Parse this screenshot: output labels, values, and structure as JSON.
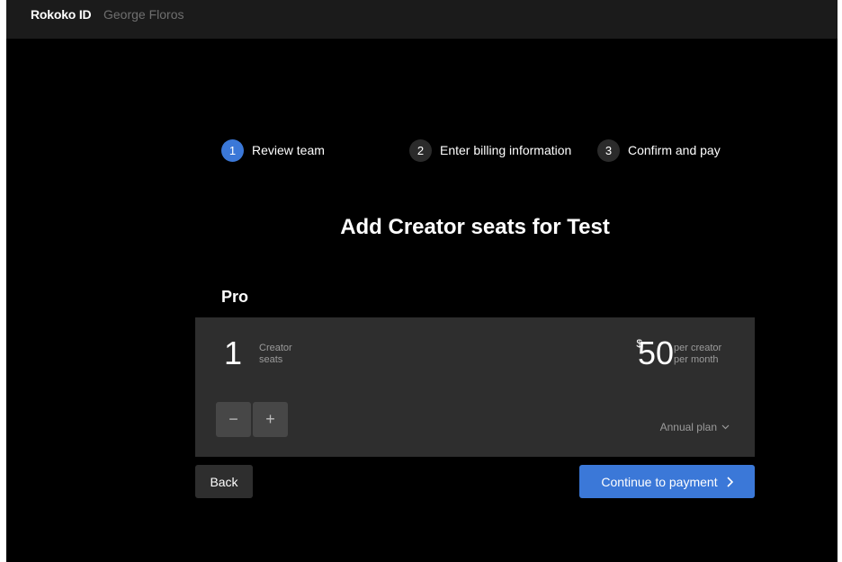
{
  "header": {
    "brand": "Rokoko ID",
    "user": "George Floros"
  },
  "steps": [
    {
      "number": "1",
      "label": "Review team",
      "active": true
    },
    {
      "number": "2",
      "label": "Enter billing information",
      "active": false
    },
    {
      "number": "3",
      "label": "Confirm and pay",
      "active": false
    }
  ],
  "page_title": "Add Creator seats for Test",
  "plan": {
    "name": "Pro",
    "seats_count": "1",
    "seats_label_line1": "Creator",
    "seats_label_line2": "seats",
    "currency": "$",
    "price": "50",
    "price_unit_line1": "per creator",
    "price_unit_line2": "per month",
    "minus_label": "−",
    "plus_label": "+",
    "billing_period": "Annual plan"
  },
  "actions": {
    "back_label": "Back",
    "continue_label": "Continue to payment"
  },
  "colors": {
    "accent": "#3b78d8",
    "background": "#000000",
    "card": "#2e2e2e"
  }
}
